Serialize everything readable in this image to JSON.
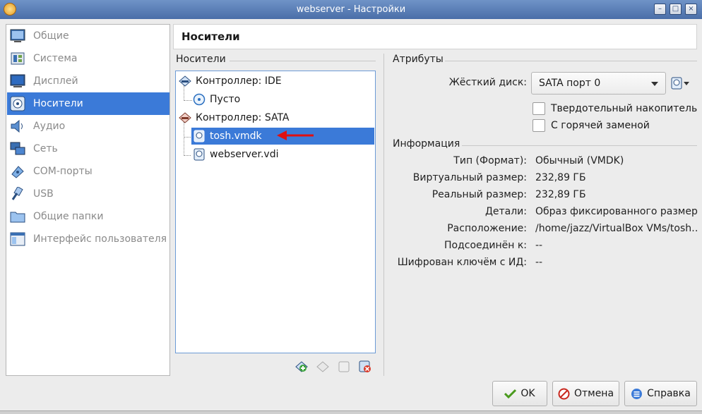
{
  "window": {
    "title": "webserver - Настройки"
  },
  "nav": {
    "items": [
      {
        "label": "Общие",
        "icon": "general-icon"
      },
      {
        "label": "Система",
        "icon": "system-icon"
      },
      {
        "label": "Дисплей",
        "icon": "display-icon"
      },
      {
        "label": "Носители",
        "icon": "storage-icon",
        "active": true
      },
      {
        "label": "Аудио",
        "icon": "audio-icon"
      },
      {
        "label": "Сеть",
        "icon": "network-icon"
      },
      {
        "label": "COM-порты",
        "icon": "serial-port-icon"
      },
      {
        "label": "USB",
        "icon": "usb-icon"
      },
      {
        "label": "Общие папки",
        "icon": "shared-folder-icon"
      },
      {
        "label": "Интерфейс пользователя",
        "icon": "user-interface-icon"
      }
    ]
  },
  "header": {
    "title": "Носители"
  },
  "storage": {
    "section_title": "Носители",
    "tree": [
      {
        "label": "Контроллер: IDE",
        "kind": "controller"
      },
      {
        "label": "Пусто",
        "kind": "optical"
      },
      {
        "label": "Контроллер: SATA",
        "kind": "controller"
      },
      {
        "label": "tosh.vmdk",
        "kind": "disk",
        "selected": true
      },
      {
        "label": "webserver.vdi",
        "kind": "disk"
      }
    ],
    "annotation_color": "#e01010"
  },
  "attributes": {
    "section_title": "Атрибуты",
    "hard_disk_label": "Жёсткий диск:",
    "hard_disk_value": "SATA порт 0",
    "ssd_label": "Твердотельный накопитель",
    "hotplug_label": "С горячей заменой"
  },
  "information": {
    "section_title": "Информация",
    "rows": [
      {
        "label": "Тип (Формат):",
        "value": "Обычный (VMDK)"
      },
      {
        "label": "Виртуальный размер:",
        "value": "232,89 ГБ"
      },
      {
        "label": "Реальный размер:",
        "value": "232,89 ГБ"
      },
      {
        "label": "Детали:",
        "value": "Образ фиксированного размер…"
      },
      {
        "label": "Расположение:",
        "value": "/home/jazz/VirtualBox VMs/tosh…"
      },
      {
        "label": "Подсоединён к:",
        "value": "--"
      },
      {
        "label": "Шифрован ключём с ИД:",
        "value": "--"
      }
    ]
  },
  "buttons": {
    "ok": "OK",
    "cancel": "Отмена",
    "help": "Справка"
  },
  "colors": {
    "accent": "#3b7ad8",
    "titlebar": "#5a7fb8"
  }
}
